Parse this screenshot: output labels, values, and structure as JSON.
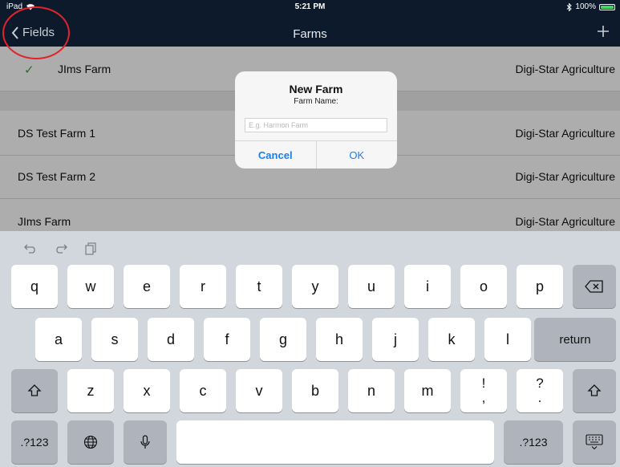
{
  "status_bar": {
    "device": "iPad",
    "time": "5:21 PM",
    "battery": "100%"
  },
  "nav": {
    "back_label": "Fields",
    "title": "Farms",
    "add_icon": "plus-icon"
  },
  "farms": [
    {
      "name": "JIms Farm",
      "org": "Digi-Star Agriculture",
      "selected": true
    },
    {
      "name": "DS Test Farm 1",
      "org": "Digi-Star Agriculture",
      "selected": false
    },
    {
      "name": "DS Test Farm 2",
      "org": "Digi-Star Agriculture",
      "selected": false
    },
    {
      "name": "JIms Farm",
      "org": "Digi-Star Agriculture",
      "selected": false
    }
  ],
  "alert": {
    "title": "New Farm",
    "message": "Farm Name:",
    "input_value": "",
    "input_placeholder": "E.g. Harmon Farm",
    "cancel_label": "Cancel",
    "ok_label": "OK"
  },
  "keyboard": {
    "tools": [
      "undo-icon",
      "redo-icon",
      "paste-icon"
    ],
    "row1": [
      "q",
      "w",
      "e",
      "r",
      "t",
      "y",
      "u",
      "i",
      "o",
      "p"
    ],
    "row2": [
      "a",
      "s",
      "d",
      "f",
      "g",
      "h",
      "j",
      "k",
      "l"
    ],
    "row3": [
      "z",
      "x",
      "c",
      "v",
      "b",
      "n",
      "m"
    ],
    "punct1": {
      "top": "!",
      "bottom": ","
    },
    "punct2": {
      "top": "?",
      "bottom": "."
    },
    "return_label": "return",
    "numbers_label": ".?123"
  },
  "colors": {
    "nav_bg": "#0d1a2c",
    "accent": "#1a7ff0",
    "annotation": "#e1232b",
    "check": "#37a83b"
  }
}
